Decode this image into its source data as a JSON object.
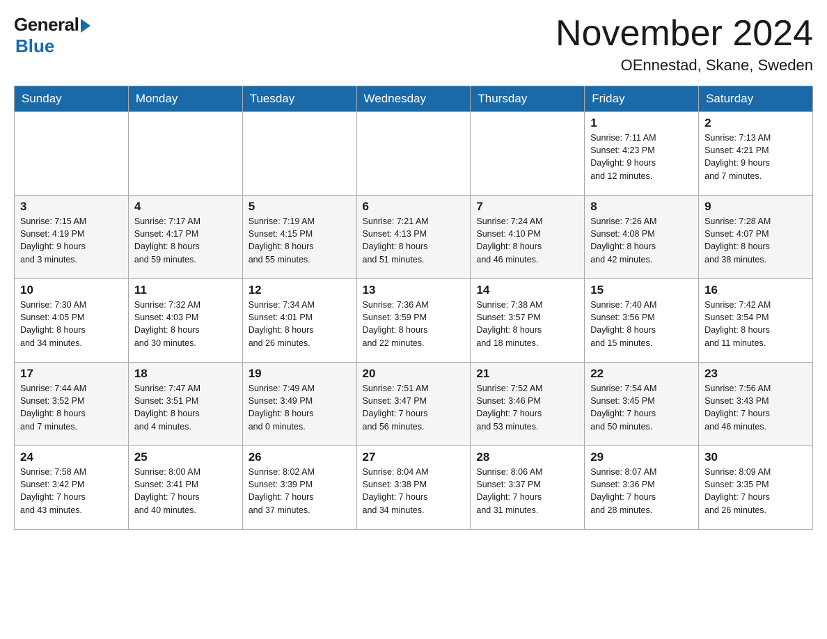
{
  "header": {
    "logo_general": "General",
    "logo_blue": "Blue",
    "month_title": "November 2024",
    "location": "OEnnestad, Skane, Sweden"
  },
  "calendar": {
    "days": [
      "Sunday",
      "Monday",
      "Tuesday",
      "Wednesday",
      "Thursday",
      "Friday",
      "Saturday"
    ],
    "weeks": [
      [
        {
          "day": "",
          "info": ""
        },
        {
          "day": "",
          "info": ""
        },
        {
          "day": "",
          "info": ""
        },
        {
          "day": "",
          "info": ""
        },
        {
          "day": "",
          "info": ""
        },
        {
          "day": "1",
          "info": "Sunrise: 7:11 AM\nSunset: 4:23 PM\nDaylight: 9 hours\nand 12 minutes."
        },
        {
          "day": "2",
          "info": "Sunrise: 7:13 AM\nSunset: 4:21 PM\nDaylight: 9 hours\nand 7 minutes."
        }
      ],
      [
        {
          "day": "3",
          "info": "Sunrise: 7:15 AM\nSunset: 4:19 PM\nDaylight: 9 hours\nand 3 minutes."
        },
        {
          "day": "4",
          "info": "Sunrise: 7:17 AM\nSunset: 4:17 PM\nDaylight: 8 hours\nand 59 minutes."
        },
        {
          "day": "5",
          "info": "Sunrise: 7:19 AM\nSunset: 4:15 PM\nDaylight: 8 hours\nand 55 minutes."
        },
        {
          "day": "6",
          "info": "Sunrise: 7:21 AM\nSunset: 4:13 PM\nDaylight: 8 hours\nand 51 minutes."
        },
        {
          "day": "7",
          "info": "Sunrise: 7:24 AM\nSunset: 4:10 PM\nDaylight: 8 hours\nand 46 minutes."
        },
        {
          "day": "8",
          "info": "Sunrise: 7:26 AM\nSunset: 4:08 PM\nDaylight: 8 hours\nand 42 minutes."
        },
        {
          "day": "9",
          "info": "Sunrise: 7:28 AM\nSunset: 4:07 PM\nDaylight: 8 hours\nand 38 minutes."
        }
      ],
      [
        {
          "day": "10",
          "info": "Sunrise: 7:30 AM\nSunset: 4:05 PM\nDaylight: 8 hours\nand 34 minutes."
        },
        {
          "day": "11",
          "info": "Sunrise: 7:32 AM\nSunset: 4:03 PM\nDaylight: 8 hours\nand 30 minutes."
        },
        {
          "day": "12",
          "info": "Sunrise: 7:34 AM\nSunset: 4:01 PM\nDaylight: 8 hours\nand 26 minutes."
        },
        {
          "day": "13",
          "info": "Sunrise: 7:36 AM\nSunset: 3:59 PM\nDaylight: 8 hours\nand 22 minutes."
        },
        {
          "day": "14",
          "info": "Sunrise: 7:38 AM\nSunset: 3:57 PM\nDaylight: 8 hours\nand 18 minutes."
        },
        {
          "day": "15",
          "info": "Sunrise: 7:40 AM\nSunset: 3:56 PM\nDaylight: 8 hours\nand 15 minutes."
        },
        {
          "day": "16",
          "info": "Sunrise: 7:42 AM\nSunset: 3:54 PM\nDaylight: 8 hours\nand 11 minutes."
        }
      ],
      [
        {
          "day": "17",
          "info": "Sunrise: 7:44 AM\nSunset: 3:52 PM\nDaylight: 8 hours\nand 7 minutes."
        },
        {
          "day": "18",
          "info": "Sunrise: 7:47 AM\nSunset: 3:51 PM\nDaylight: 8 hours\nand 4 minutes."
        },
        {
          "day": "19",
          "info": "Sunrise: 7:49 AM\nSunset: 3:49 PM\nDaylight: 8 hours\nand 0 minutes."
        },
        {
          "day": "20",
          "info": "Sunrise: 7:51 AM\nSunset: 3:47 PM\nDaylight: 7 hours\nand 56 minutes."
        },
        {
          "day": "21",
          "info": "Sunrise: 7:52 AM\nSunset: 3:46 PM\nDaylight: 7 hours\nand 53 minutes."
        },
        {
          "day": "22",
          "info": "Sunrise: 7:54 AM\nSunset: 3:45 PM\nDaylight: 7 hours\nand 50 minutes."
        },
        {
          "day": "23",
          "info": "Sunrise: 7:56 AM\nSunset: 3:43 PM\nDaylight: 7 hours\nand 46 minutes."
        }
      ],
      [
        {
          "day": "24",
          "info": "Sunrise: 7:58 AM\nSunset: 3:42 PM\nDaylight: 7 hours\nand 43 minutes."
        },
        {
          "day": "25",
          "info": "Sunrise: 8:00 AM\nSunset: 3:41 PM\nDaylight: 7 hours\nand 40 minutes."
        },
        {
          "day": "26",
          "info": "Sunrise: 8:02 AM\nSunset: 3:39 PM\nDaylight: 7 hours\nand 37 minutes."
        },
        {
          "day": "27",
          "info": "Sunrise: 8:04 AM\nSunset: 3:38 PM\nDaylight: 7 hours\nand 34 minutes."
        },
        {
          "day": "28",
          "info": "Sunrise: 8:06 AM\nSunset: 3:37 PM\nDaylight: 7 hours\nand 31 minutes."
        },
        {
          "day": "29",
          "info": "Sunrise: 8:07 AM\nSunset: 3:36 PM\nDaylight: 7 hours\nand 28 minutes."
        },
        {
          "day": "30",
          "info": "Sunrise: 8:09 AM\nSunset: 3:35 PM\nDaylight: 7 hours\nand 26 minutes."
        }
      ]
    ]
  }
}
